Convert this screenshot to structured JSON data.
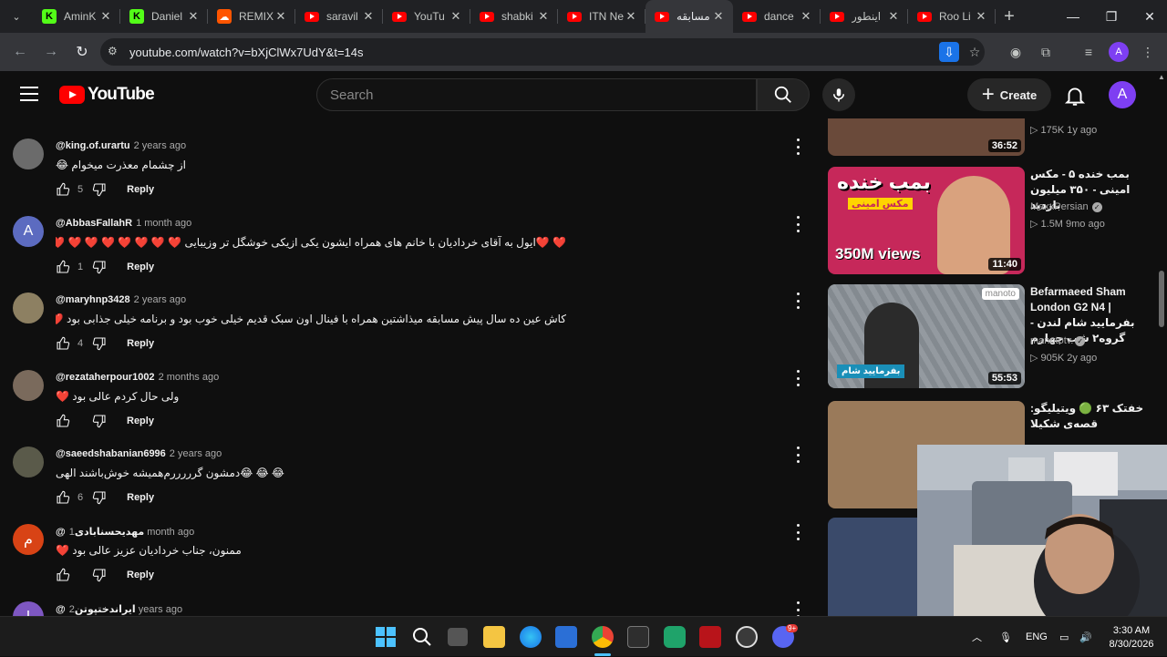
{
  "browser": {
    "tabs": [
      {
        "label": "AminK",
        "favicon": "kick-icon",
        "color": "#53fc18",
        "active": false
      },
      {
        "label": "Daniel",
        "favicon": "kick-icon",
        "color": "#53fc18",
        "active": false
      },
      {
        "label": "REMIX",
        "favicon": "soundcloud-icon",
        "color": "#ff5500",
        "active": false
      },
      {
        "label": "saravil",
        "favicon": "youtube-icon",
        "color": "#ff0000",
        "active": false
      },
      {
        "label": "YouTu",
        "favicon": "youtube-icon",
        "color": "#ff0000",
        "active": false
      },
      {
        "label": "shabki",
        "favicon": "youtube-icon",
        "color": "#ff0000",
        "active": false
      },
      {
        "label": "ITN Ne",
        "favicon": "youtube-icon",
        "color": "#ff0000",
        "active": false
      },
      {
        "label": "مسابقه",
        "favicon": "youtube-icon",
        "color": "#ff0000",
        "active": true
      },
      {
        "label": "dance",
        "favicon": "youtube-icon",
        "color": "#ff0000",
        "active": false
      },
      {
        "label": "اینطور",
        "favicon": "youtube-icon",
        "color": "#ff0000",
        "active": false
      },
      {
        "label": "Roo Li",
        "favicon": "youtube-icon",
        "color": "#ff0000",
        "active": false
      }
    ],
    "url": "youtube.com/watch?v=bXjClWx7UdY&t=14s",
    "profile_initial": "A"
  },
  "youtube": {
    "logo_text": "YouTube",
    "search_placeholder": "Search",
    "create_label": "Create",
    "avatar_initial": "A"
  },
  "comments": [
    {
      "handle": "@king.of.urartu",
      "age": "2 years ago",
      "text": "از چشمام معذرت میخوام 😂",
      "likes": "5",
      "avatar_color": "#6b6b6b",
      "avatar_letter": ""
    },
    {
      "handle": "@AbbasFallahR",
      "age": "1 month ago",
      "text": "❤️ ❤️ایول به آقای خردادیان با خانم های همراه ایشون یکی ازیکی خوشگل تر وزیبایی ❤️ ❤️ ❤️ ❤️ ❤️ ❤️ ❤️ ❤️ ❤️ ❤️",
      "likes": "1",
      "avatar_color": "#5c6bc0",
      "avatar_letter": "A"
    },
    {
      "handle": "@maryhnp3428",
      "age": "2 years ago",
      "text": "کاش عین ده سال پیش مسابقه میذاشتین همراه با فینال اون سبک قدیم خیلی خوب بود و برنامه خیلی جذابی بود ❤️",
      "likes": "4",
      "avatar_color": "#8d8062",
      "avatar_letter": ""
    },
    {
      "handle": "@rezataherpour1002",
      "age": "2 months ago",
      "text": "ولی حال کردم عالی بود ❤️",
      "likes": "",
      "avatar_color": "#7a6a5c",
      "avatar_letter": ""
    },
    {
      "handle": "@saeedshabanian6996",
      "age": "2 years ago",
      "text": "😂 😂 😂دمشون گرررررم‌همیشه خوش‌باشند الهی",
      "likes": "6",
      "avatar_color": "#5a5a4a",
      "avatar_letter": ""
    },
    {
      "handle": "@مهدیحسنابادی",
      "age": "1 month ago",
      "text": "ممنون، جناب خردادیان عزیز عالی بود ❤️",
      "likes": "",
      "avatar_color": "#d84315",
      "avatar_letter": "م"
    },
    {
      "handle": "@ایراندختپوتن",
      "age": "2 years ago",
      "text": "",
      "likes": "",
      "avatar_color": "#7e57c2",
      "avatar_letter": "ا"
    }
  ],
  "reply_label": "Reply",
  "related": [
    {
      "title": "",
      "channel": "",
      "meta": "▷ 175K   1y ago",
      "duration": "36:52",
      "thumb_color": "#6a4a3a"
    },
    {
      "title": "بمب خنده ۵ - مکس امینی - ۳۵۰ میلیون بازدید",
      "channel": "MaxxPersian",
      "meta": "▷ 1.5M   9mo ago",
      "duration": "11:40",
      "thumb_color": "#c6285a",
      "thumb_text": "بمب خنده",
      "thumb_sub": "مکس امینی",
      "thumb_views": "350M views"
    },
    {
      "title": "Befarmaeed Sham London G2 N4 | بفرمایید شام لندن - گروه۲ شب چهارم",
      "channel": "manototv",
      "meta": "▷ 905K   2y ago",
      "duration": "55:53",
      "thumb_color": "#8a8f94",
      "thumb_badge": "بفرمایید شام",
      "thumb_brand": "manoto"
    },
    {
      "title": "خفتک ۶۳ 🟢 ویتیلیگو: قصه‌ی شکیلا",
      "channel": "",
      "meta": "",
      "duration": "",
      "thumb_color": "#9a7a5a"
    },
    {
      "title": "",
      "channel": "",
      "meta": "",
      "duration": "",
      "thumb_color": "#3a4a6a"
    }
  ],
  "taskbar": {
    "lang": "ENG",
    "time": "3:30 AM",
    "date": "8/30/2026",
    "discord_badge": "9+"
  }
}
